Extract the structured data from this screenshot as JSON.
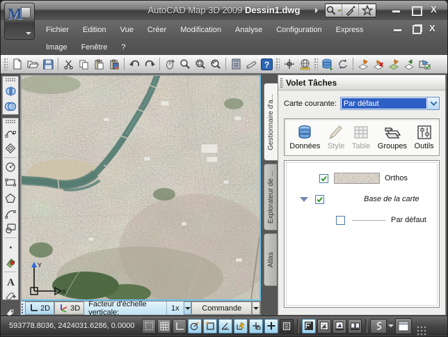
{
  "window": {
    "title_app": "AutoCAD Map 3D 2009",
    "title_doc": "Dessin1.dwg"
  },
  "menubar": {
    "row1": [
      "Fichier",
      "Edition",
      "Vue",
      "Créer",
      "Modification",
      "Analyse",
      "Configuration",
      "Express"
    ],
    "row2": [
      "Image",
      "Fenêtre",
      "?"
    ]
  },
  "viewport": {
    "ucs_x_label": "X",
    "ucs_y_label": "Y",
    "statusrow": {
      "btn_2d": "2D",
      "btn_3d": "3D",
      "scale_label": "Facteur d'échelle verticale:",
      "scale_value": "1x",
      "command_label": "Commande"
    }
  },
  "side_tabs": [
    "Gestionnaire d'a...",
    "Explorateur de ...",
    "Atlas"
  ],
  "taskpane": {
    "title": "Volet Tâches",
    "current_map_label": "Carte courante:",
    "current_map_value": "Par défaut",
    "tools": [
      {
        "label": "Données",
        "enabled": true
      },
      {
        "label": "Style",
        "enabled": false
      },
      {
        "label": "Table",
        "enabled": false
      },
      {
        "label": "Groupes",
        "enabled": true
      },
      {
        "label": "Outils",
        "enabled": true
      }
    ],
    "tree": [
      {
        "label": "Orthos",
        "checked": true,
        "has_thumbnail": true
      },
      {
        "label": "Base de la carte",
        "checked": true,
        "italic": true,
        "expanded": true
      },
      {
        "label": "Par défaut",
        "checked": false,
        "indented": true,
        "has_legend_line": true
      }
    ]
  },
  "statusbar": {
    "coordinates": "593778.8036, 2424031.6286, 0.0000"
  },
  "colors": {
    "accent_blue": "#6fc1ea",
    "selection_blue": "#2e5fc4",
    "toggle_on": "#b4ddf1",
    "river": "#5d8379",
    "park_green": "#44603a"
  },
  "icons": {
    "titlebar": [
      "m-logo",
      "menu-browser-caret",
      "infocenter-arrow",
      "search",
      "communication-center",
      "favorites-star",
      "minimize",
      "maximize",
      "close"
    ],
    "toolbar": [
      "new-file",
      "open-folder",
      "save",
      "cut-scissors",
      "copy",
      "paste",
      "paste-special",
      "undo",
      "redo",
      "pan",
      "zoom",
      "zoom-window",
      "zoom-previous",
      "properties-palette",
      "tool-palettes",
      "help",
      "crosshair-select",
      "globe-ruler",
      "database-add",
      "refresh-sync",
      "map-checkout",
      "map-cancel-checkout",
      "map-checkin",
      "map-update",
      "map-save-edit"
    ],
    "left_toolbar": [
      "mirror-halves",
      "overlap-ellipses",
      "spline",
      "donut",
      "circle",
      "rectangle",
      "polygon",
      "arc",
      "region-shapes",
      "point",
      "hatch-stamp",
      "text-a",
      "tag-crosshair",
      "tag-label"
    ],
    "taskpane_tools": [
      "database-cylinder",
      "style-brush",
      "table-grid",
      "groups-layers",
      "tools-sliders"
    ],
    "statusbar": [
      "snap",
      "grid",
      "ortho",
      "polar",
      "osnap",
      "otrack",
      "ducs",
      "dyn",
      "lineweight",
      "quick-properties",
      "model",
      "layout",
      "layout-preview",
      "quickview",
      "annotation-scale",
      "clean-screen",
      "resize-grip"
    ]
  }
}
